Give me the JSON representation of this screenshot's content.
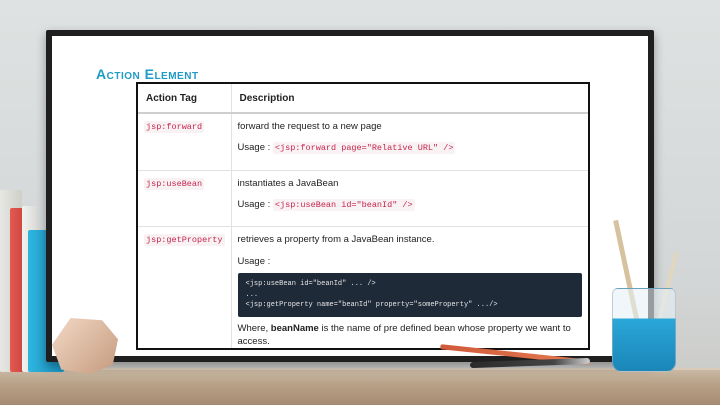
{
  "slide": {
    "title": "Action Element"
  },
  "table": {
    "headers": [
      "Action Tag",
      "Description"
    ],
    "rows": [
      {
        "tag": "jsp:forward",
        "description": "forward the request to a new page",
        "usage_label": "Usage :",
        "usage_code": "<jsp:forward page=\"Relative URL\" />"
      },
      {
        "tag": "jsp:useBean",
        "description": "instantiates a JavaBean",
        "usage_label": "Usage :",
        "usage_code": "<jsp:useBean id=\"beanId\" />"
      },
      {
        "tag": "jsp:getProperty",
        "description": "retrieves a property from a JavaBean instance.",
        "usage_label": "Usage :",
        "code_block": [
          "<jsp:useBean id=\"beanId\" ... />",
          "...",
          "<jsp:getProperty name=\"beanId\" property=\"someProperty\" .../>"
        ],
        "where_text_1": "Where, ",
        "where_bold": "beanName",
        "where_text_2": " is the name of pre defined bean whose property we want to access."
      }
    ]
  },
  "colors": {
    "title": "#1f9bc6",
    "code_tag_text": "#c7254e",
    "code_block_bg": "#1e2a38"
  }
}
